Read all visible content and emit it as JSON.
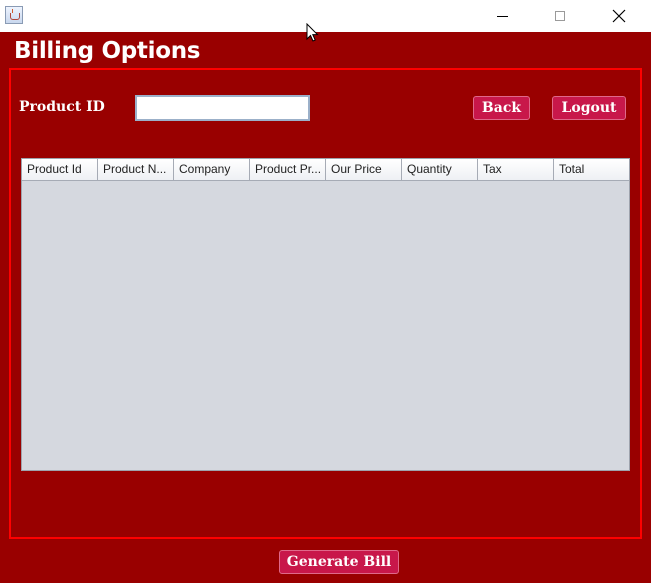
{
  "window": {
    "icon": "java-cup-icon",
    "controls": {
      "minimize": "minimize-icon",
      "maximize": "maximize-icon",
      "close": "close-icon"
    }
  },
  "heading": "Billing Options",
  "form": {
    "product_id_label": "Product ID",
    "product_id_value": "",
    "back_label": "Back",
    "logout_label": "Logout"
  },
  "table": {
    "columns": [
      "Product Id",
      "Product N...",
      "Company",
      "Product Pr...",
      "Our Price",
      "Quantity",
      "Tax",
      "Total"
    ],
    "rows": []
  },
  "footer": {
    "generate_bill_label": "Generate Bill"
  },
  "colors": {
    "background": "#990000",
    "panel_border": "#ff0000",
    "button": "#c8174a",
    "table_body": "#d5d8df"
  }
}
